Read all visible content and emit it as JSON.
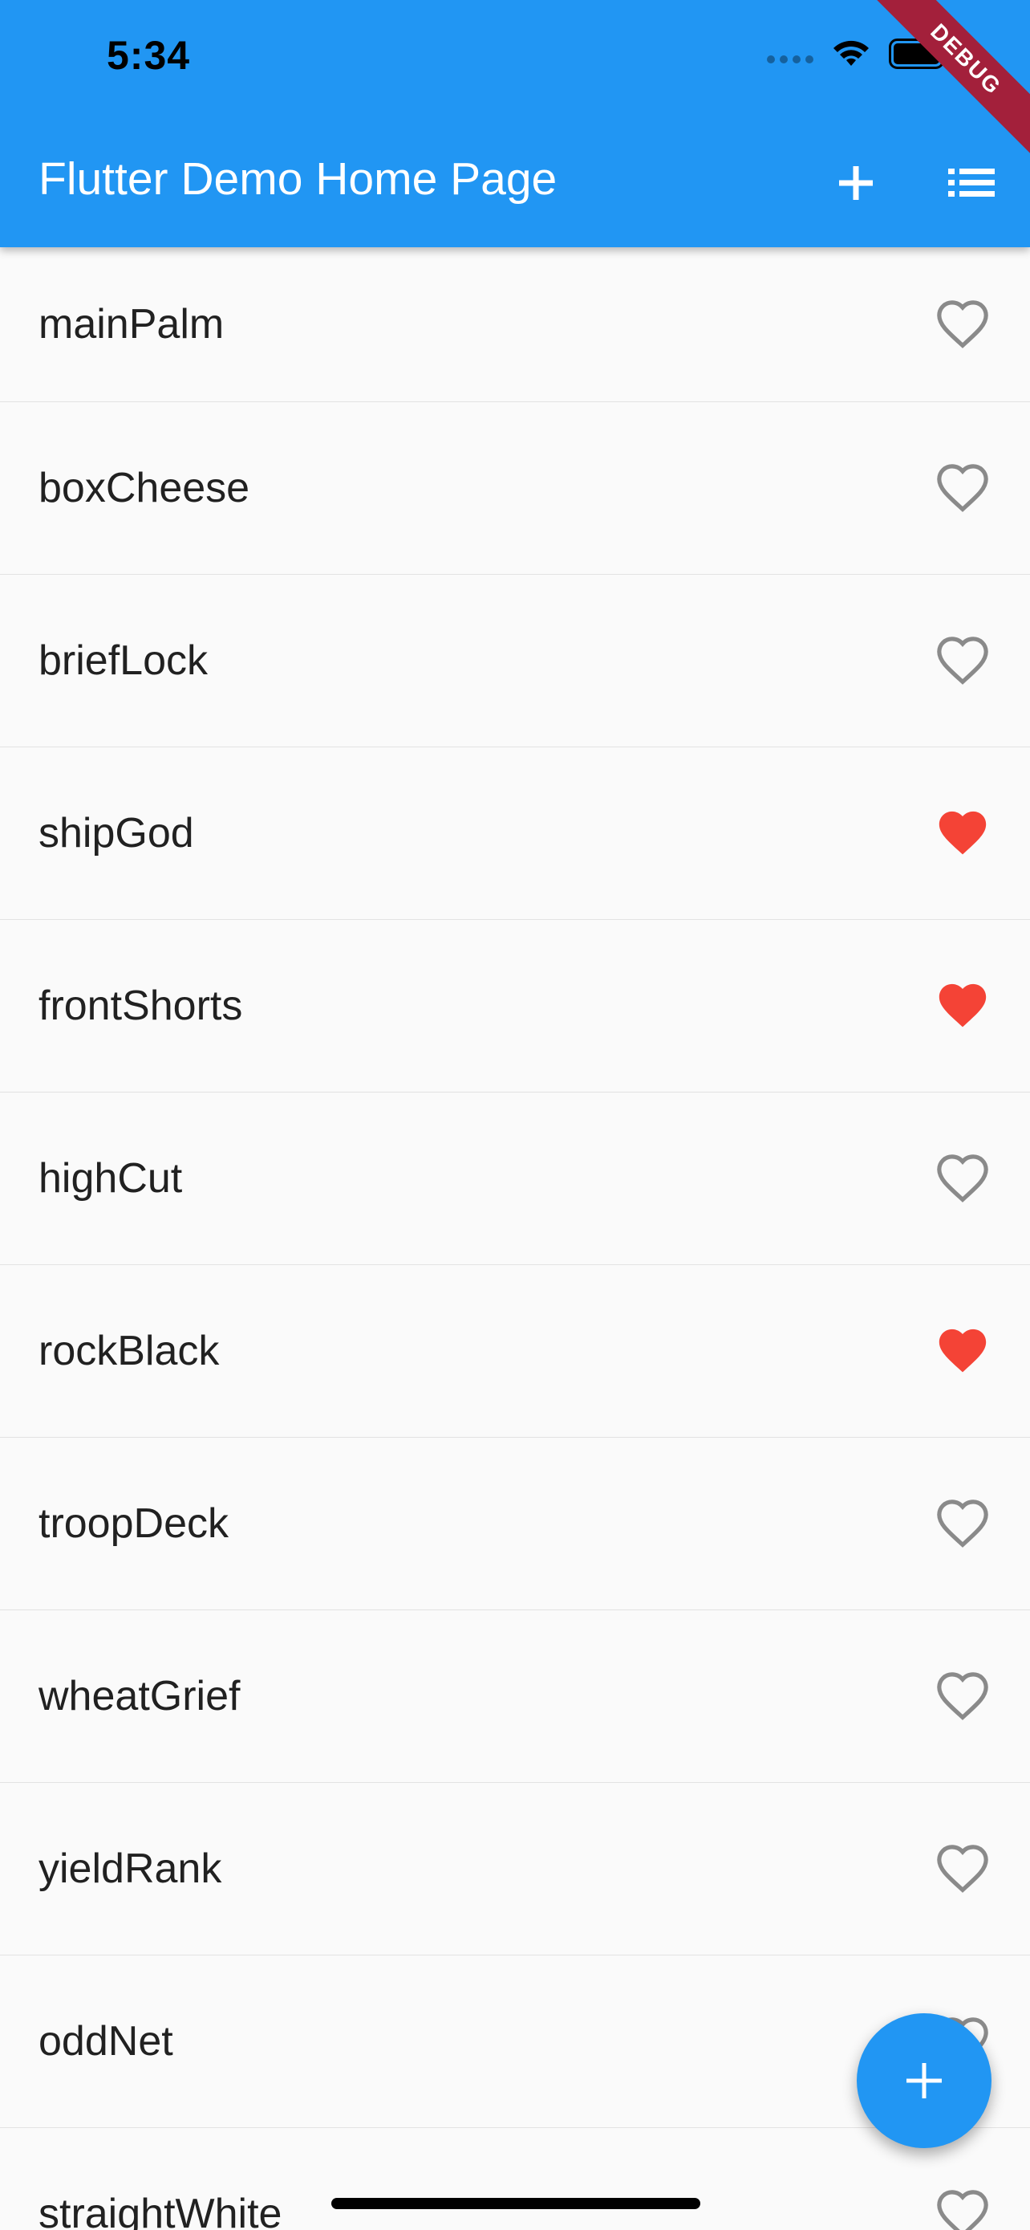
{
  "status_bar": {
    "time": "5:34",
    "icons": [
      "signal-dots-icon",
      "wifi-icon",
      "battery-icon"
    ]
  },
  "debug_banner": {
    "label": "DEBUG",
    "color": "#a3203b"
  },
  "app_bar": {
    "title": "Flutter Demo Home Page",
    "color": "#2196f3",
    "actions": [
      "add-icon",
      "list-icon"
    ]
  },
  "list": {
    "items": [
      {
        "label": "mainPalm",
        "favorited": false
      },
      {
        "label": "boxCheese",
        "favorited": false
      },
      {
        "label": "briefLock",
        "favorited": false
      },
      {
        "label": "shipGod",
        "favorited": true
      },
      {
        "label": "frontShorts",
        "favorited": true
      },
      {
        "label": "highCut",
        "favorited": false
      },
      {
        "label": "rockBlack",
        "favorited": true
      },
      {
        "label": "troopDeck",
        "favorited": false
      },
      {
        "label": "wheatGrief",
        "favorited": false
      },
      {
        "label": "yieldRank",
        "favorited": false
      },
      {
        "label": "oddNet",
        "favorited": false
      },
      {
        "label": "straightWhite",
        "favorited": false
      }
    ],
    "favorite_color": "#f44336",
    "outline_color": "#8a8a8a"
  },
  "fab": {
    "icon": "add-icon",
    "color": "#2196f3"
  }
}
